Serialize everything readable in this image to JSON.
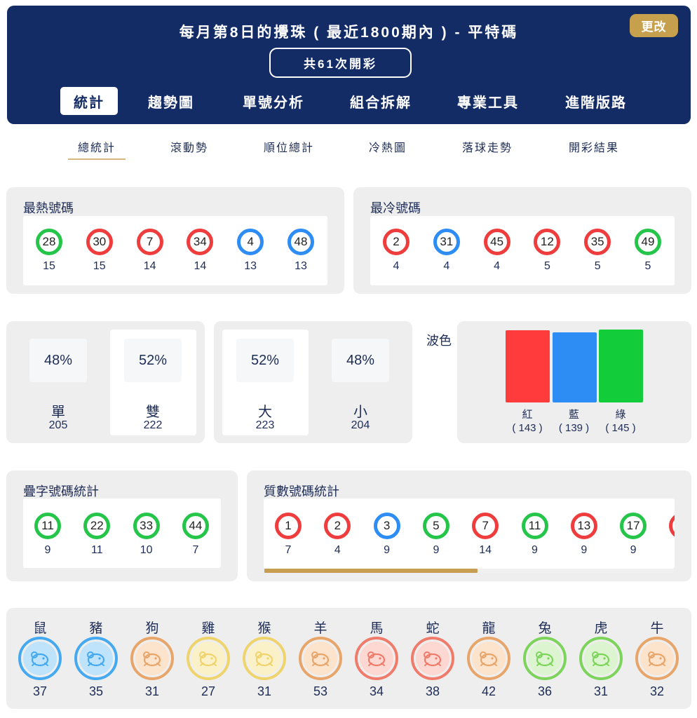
{
  "header": {
    "title": "每月第8日的攪珠 ( 最近1800期內 ) - 平特碼",
    "change_button": "更改",
    "draw_count": "共61次開彩",
    "tabs": [
      "統計",
      "趨勢圖",
      "單號分析",
      "組合拆解",
      "專業工具",
      "進階版路"
    ]
  },
  "sub_tabs": [
    "總統計",
    "滾動勢",
    "順位總計",
    "冷熱圖",
    "落球走勢",
    "開彩結果"
  ],
  "colors": {
    "red": "#ef3d3d",
    "blue": "#2e8cf5",
    "green": "#25c54a",
    "navy": "#142c65",
    "gold": "#c7a04e"
  },
  "hot_numbers": {
    "title": "最熱號碼",
    "items": [
      {
        "num": "28",
        "count": "15",
        "color": "green"
      },
      {
        "num": "30",
        "count": "15",
        "color": "red"
      },
      {
        "num": "7",
        "count": "14",
        "color": "red"
      },
      {
        "num": "34",
        "count": "14",
        "color": "red"
      },
      {
        "num": "4",
        "count": "13",
        "color": "blue"
      },
      {
        "num": "48",
        "count": "13",
        "color": "blue"
      }
    ]
  },
  "cold_numbers": {
    "title": "最冷號碼",
    "items": [
      {
        "num": "2",
        "count": "4",
        "color": "red"
      },
      {
        "num": "31",
        "count": "4",
        "color": "blue"
      },
      {
        "num": "45",
        "count": "4",
        "color": "red"
      },
      {
        "num": "12",
        "count": "5",
        "color": "red"
      },
      {
        "num": "35",
        "count": "5",
        "color": "red"
      },
      {
        "num": "49",
        "count": "5",
        "color": "green"
      }
    ]
  },
  "odd_even": [
    {
      "pct": "48%",
      "label": "單",
      "count": "205"
    },
    {
      "pct": "52%",
      "label": "雙",
      "count": "222"
    }
  ],
  "big_small": [
    {
      "pct": "52%",
      "label": "大",
      "count": "223"
    },
    {
      "pct": "48%",
      "label": "小",
      "count": "204"
    }
  ],
  "wave": {
    "title": "波色",
    "bars": [
      {
        "label": "紅",
        "count": "( 143 )",
        "value": 143,
        "color": "#ff3b3b"
      },
      {
        "label": "藍",
        "count": "( 139 )",
        "value": 139,
        "color": "#2e8cf5"
      },
      {
        "label": "綠",
        "count": "( 145 )",
        "value": 145,
        "color": "#12cc3a"
      }
    ]
  },
  "repeat_numbers": {
    "title": "疊字號碼統計",
    "items": [
      {
        "num": "11",
        "count": "9",
        "color": "green"
      },
      {
        "num": "22",
        "count": "11",
        "color": "green"
      },
      {
        "num": "33",
        "count": "10",
        "color": "green"
      },
      {
        "num": "44",
        "count": "7",
        "color": "green"
      }
    ]
  },
  "prime_numbers": {
    "title": "質數號碼統計",
    "items": [
      {
        "num": "1",
        "count": "7",
        "color": "red"
      },
      {
        "num": "2",
        "count": "4",
        "color": "red"
      },
      {
        "num": "3",
        "count": "9",
        "color": "blue"
      },
      {
        "num": "5",
        "count": "9",
        "color": "green"
      },
      {
        "num": "7",
        "count": "14",
        "color": "red"
      },
      {
        "num": "11",
        "count": "9",
        "color": "green"
      },
      {
        "num": "13",
        "count": "9",
        "color": "red"
      },
      {
        "num": "17",
        "count": "9",
        "color": "green"
      }
    ],
    "scroll_progress": 0.52
  },
  "zodiac": [
    {
      "name": "鼠",
      "count": "37",
      "icon": "rat-icon",
      "ring": "#45a9f0",
      "bg": "#bfe3fb"
    },
    {
      "name": "豬",
      "count": "35",
      "icon": "pig-icon",
      "ring": "#45a9f0",
      "bg": "#bfe3fb"
    },
    {
      "name": "狗",
      "count": "31",
      "icon": "dog-icon",
      "ring": "#e8a56a",
      "bg": "#fbe3cc"
    },
    {
      "name": "雞",
      "count": "27",
      "icon": "rooster-icon",
      "ring": "#efd36b",
      "bg": "#fbf1c8"
    },
    {
      "name": "猴",
      "count": "31",
      "icon": "monkey-icon",
      "ring": "#efd36b",
      "bg": "#fbf1c8"
    },
    {
      "name": "羊",
      "count": "53",
      "icon": "goat-icon",
      "ring": "#e8a56a",
      "bg": "#fbe3cc"
    },
    {
      "name": "馬",
      "count": "34",
      "icon": "horse-icon",
      "ring": "#f07b6a",
      "bg": "#fdd8d2"
    },
    {
      "name": "蛇",
      "count": "38",
      "icon": "snake-icon",
      "ring": "#f07b6a",
      "bg": "#fdd8d2"
    },
    {
      "name": "龍",
      "count": "42",
      "icon": "dragon-icon",
      "ring": "#e8a56a",
      "bg": "#fbe3cc"
    },
    {
      "name": "兔",
      "count": "36",
      "icon": "rabbit-icon",
      "ring": "#7cd45b",
      "bg": "#dcf4cf"
    },
    {
      "name": "虎",
      "count": "31",
      "icon": "tiger-icon",
      "ring": "#7cd45b",
      "bg": "#dcf4cf"
    },
    {
      "name": "牛",
      "count": "32",
      "icon": "ox-icon",
      "ring": "#e8a56a",
      "bg": "#fbe3cc"
    }
  ]
}
